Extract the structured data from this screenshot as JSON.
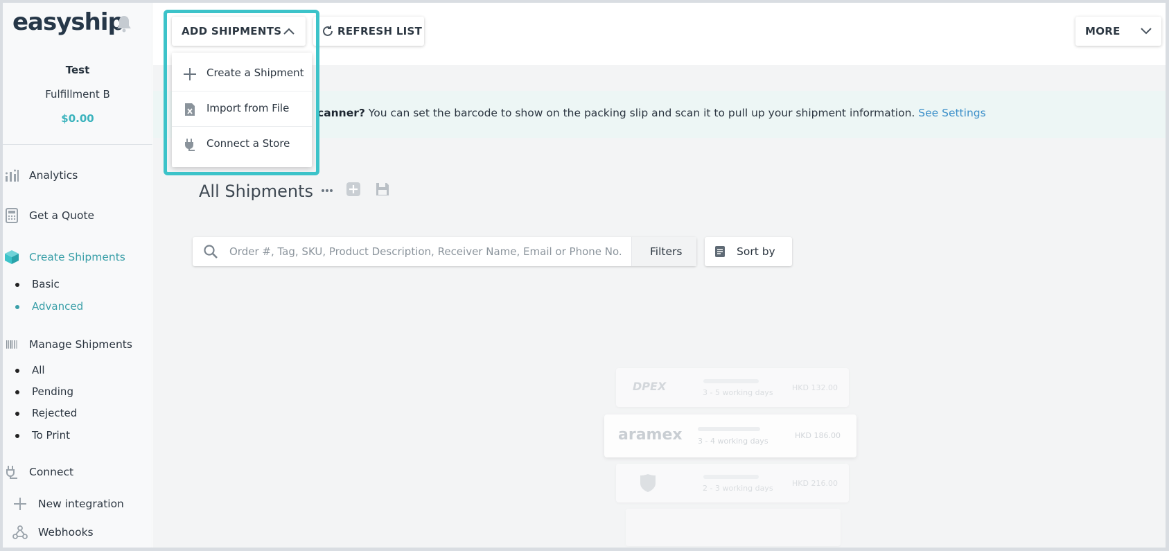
{
  "brand": {
    "logo_text": "easyship"
  },
  "account": {
    "name": "Test",
    "subtitle": "Fulfillment B",
    "balance": "$0.00"
  },
  "sidebar": {
    "analytics": "Analytics",
    "quote": "Get a Quote",
    "create": "Create Shipments",
    "create_sub": [
      "Basic",
      "Advanced"
    ],
    "manage": "Manage Shipments",
    "manage_sub": [
      "All",
      "Pending",
      "Rejected",
      "To Print"
    ],
    "connect": "Connect",
    "new_integration": "New integration",
    "webhooks": "Webhooks"
  },
  "toolbar": {
    "add": "ADD SHIPMENTS",
    "refresh": "REFRESH LIST",
    "more": "MORE"
  },
  "dropdown": {
    "items": [
      "Create a Shipment",
      "Import from File",
      "Connect a Store"
    ]
  },
  "banner": {
    "bold": "canner?",
    "text": " You can set the barcode to show on the packing slip and scan it to pull up your shipment information. ",
    "link": "See Settings"
  },
  "main": {
    "title": "All Shipments"
  },
  "search": {
    "placeholder": "Order #, Tag, SKU, Product Description, Receiver Name, Email or Phone No.",
    "filters": "Filters",
    "sort": "Sort by"
  },
  "placeholder_cards": [
    {
      "carrier": "DPEX",
      "days": "3 - 5 working days",
      "price": "HKD 132.00"
    },
    {
      "carrier": "aramex",
      "days": "3 - 4 working days",
      "price": "HKD 186.00"
    },
    {
      "carrier": "",
      "days": "2 - 3 working days",
      "price": "HKD 216.00"
    }
  ],
  "colors": {
    "accent": "#3cc3c9",
    "teal_text": "#3a9fa8",
    "link": "#3b8fc9",
    "banner_bg": "#edf6f5"
  }
}
